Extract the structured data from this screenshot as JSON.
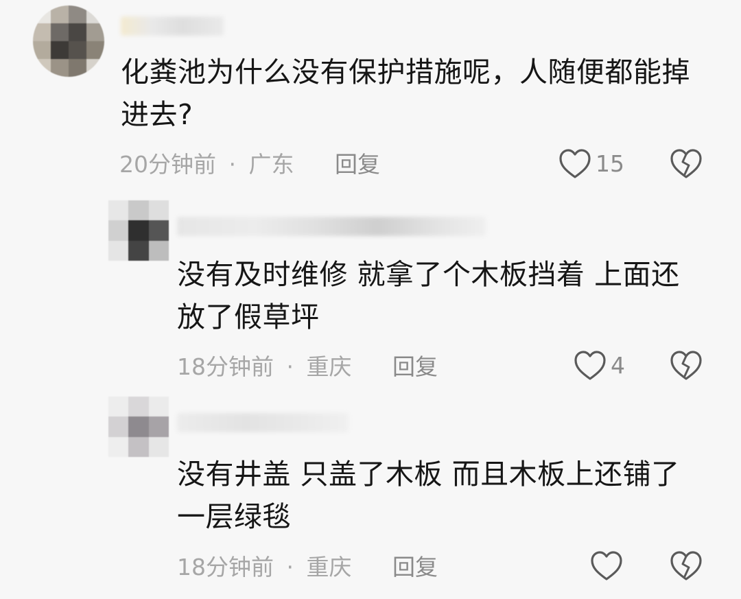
{
  "comments": [
    {
      "text_line1": "化粪池为什么没有保护措施呢，人随便都能掉",
      "text_line2": "进去?",
      "time": "20分钟前",
      "separator": "·",
      "location": "广东",
      "reply_label": "回复",
      "like_count": "15"
    }
  ],
  "replies": [
    {
      "text_line1": "没有及时维修 就拿了个木板挡着 上面还",
      "text_line2": "放了假草坪",
      "time": "18分钟前",
      "separator": "·",
      "location": "重庆",
      "reply_label": "回复",
      "like_count": "4"
    },
    {
      "text_line1": "没有井盖 只盖了木板 而且木板上还铺了",
      "text_line2": "一层绿毯",
      "time": "18分钟前",
      "separator": "·",
      "location": "重庆",
      "reply_label": "回复",
      "like_count": ""
    }
  ],
  "icons": {
    "like": "heart-outline-icon",
    "dislike": "broken-heart-icon"
  },
  "colors": {
    "background": "#f7f7f7",
    "text": "#161616",
    "meta": "#a6a6a6",
    "action": "#8a8a8a"
  }
}
